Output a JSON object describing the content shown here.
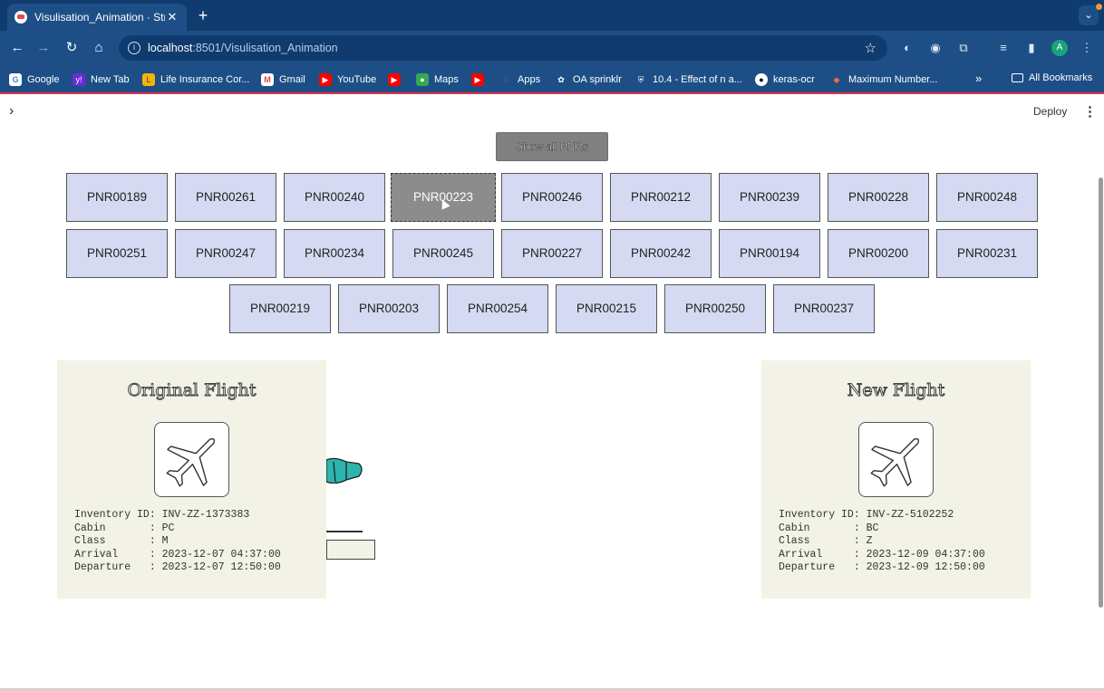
{
  "browser": {
    "tab_title": "Visulisation_Animation · Strea",
    "url_host": "localhost",
    "url_path": ":8501/Visulisation_Animation",
    "avatar_initial": "A",
    "bookmarks": [
      {
        "label": "Google",
        "icon": "google-icon",
        "color": "#ffffff"
      },
      {
        "label": "New Tab",
        "icon": "yahoo-icon",
        "color": "#6b2bd6"
      },
      {
        "label": "Life Insurance Cor...",
        "icon": "lic-icon",
        "color": "#f5b400"
      },
      {
        "label": "Gmail",
        "icon": "gmail-icon",
        "color": "#ea4335"
      },
      {
        "label": "YouTube",
        "icon": "youtube-icon",
        "color": "#ff0000"
      },
      {
        "label": "",
        "icon": "youtube-icon",
        "color": "#ff0000"
      },
      {
        "label": "Maps",
        "icon": "maps-icon",
        "color": "#34a853"
      },
      {
        "label": "",
        "icon": "youtube-icon",
        "color": "#ff0000"
      },
      {
        "label": "Apps",
        "icon": "apps-grid-icon",
        "color": "#ea4335"
      },
      {
        "label": "OA sprinklr",
        "icon": "sprinklr-icon",
        "color": "#ffffff"
      },
      {
        "label": "10.4 - Effect of n a...",
        "icon": "shield-icon",
        "color": "#ffffff"
      },
      {
        "label": "keras-ocr",
        "icon": "github-icon",
        "color": "#ffffff"
      },
      {
        "label": "Maximum Number...",
        "icon": "bookmark-icon",
        "color": "#ff6b35"
      }
    ],
    "all_bookmarks_label": "All Bookmarks"
  },
  "app": {
    "deploy_label": "Deploy",
    "show_all_label": "Show all PNRs",
    "pnr_rows": [
      [
        "PNR00189",
        "PNR00261",
        "PNR00240",
        "PNR00223",
        "PNR00246",
        "PNR00212",
        "PNR00239",
        "PNR00228",
        "PNR00248"
      ],
      [
        "PNR00251",
        "PNR00247",
        "PNR00234",
        "PNR00245",
        "PNR00227",
        "PNR00242",
        "PNR00194",
        "PNR00200",
        "PNR00231"
      ],
      [
        "PNR00219",
        "PNR00203",
        "PNR00254",
        "PNR00215",
        "PNR00250",
        "PNR00237"
      ]
    ],
    "active_pnr": "PNR00223",
    "original_flight": {
      "title": "Original Flight",
      "inventory_id": "INV-ZZ-1373383",
      "cabin": "PC",
      "class": "M",
      "arrival": "2023-12-07 04:37:00",
      "departure": "2023-12-07 12:50:00"
    },
    "new_flight": {
      "title": "New Flight",
      "inventory_id": "INV-ZZ-5102252",
      "cabin": "BC",
      "class": "Z",
      "arrival": "2023-12-09 04:37:00",
      "departure": "2023-12-09 12:50:00"
    },
    "colors": {
      "pnr_button_bg": "#d5daf2",
      "pnr_active_bg": "#8c8c8c",
      "card_bg": "#f2f2e6",
      "accent_red": "#e0314b"
    }
  }
}
